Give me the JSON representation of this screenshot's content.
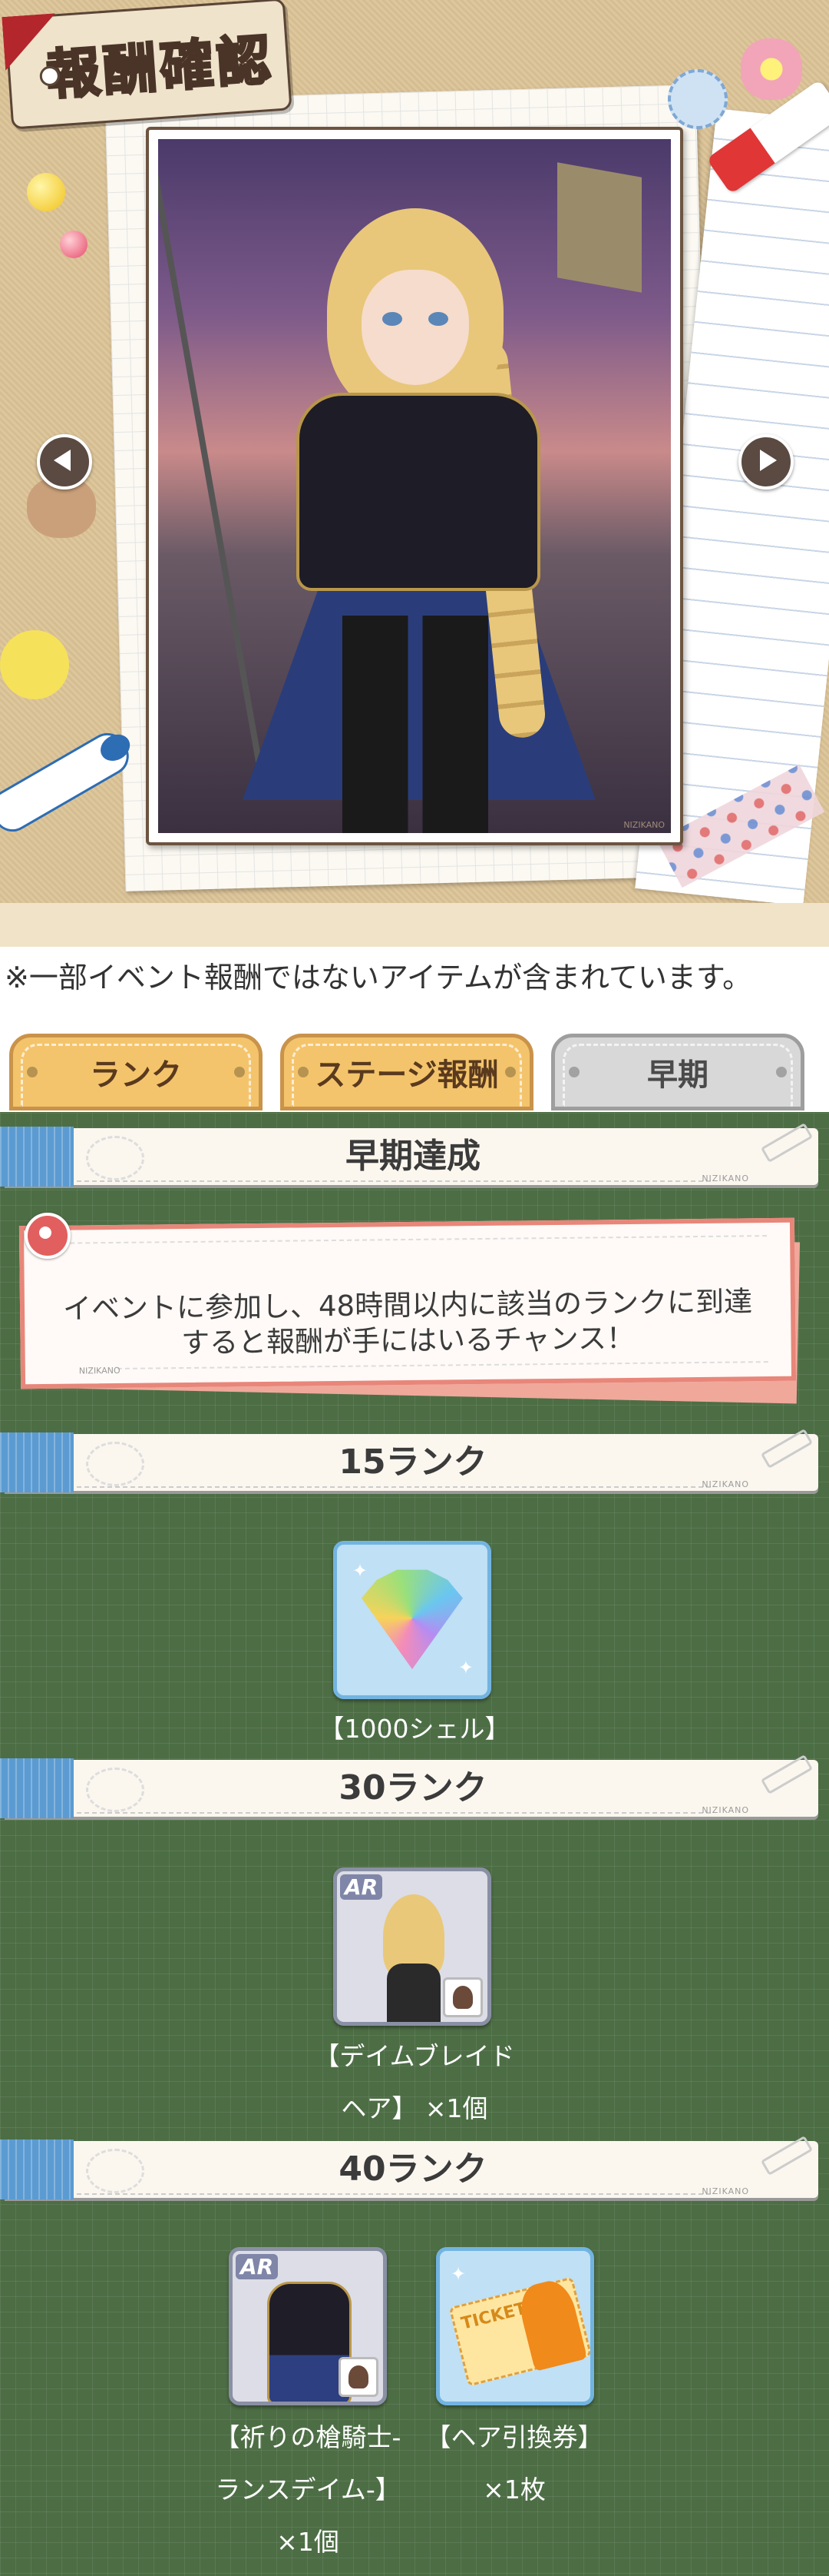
{
  "title": "報酬確認",
  "banner": {
    "signature": "NIZIKANO"
  },
  "notice": "※一部イベント報酬ではないアイテムが含まれています。",
  "tabs": [
    {
      "label": "ランク",
      "active": false
    },
    {
      "label": "ステージ報酬",
      "active": false
    },
    {
      "label": "早期",
      "active": true
    }
  ],
  "section_header": {
    "title": "早期達成",
    "stamp": "NIZIKANO"
  },
  "info": {
    "message": "イベントに参加し、48時間以内に該当のランクに到達すると報酬が手にはいるチャンス！",
    "stamp": "NIZIKANO"
  },
  "ranks": [
    {
      "title": "15ランク",
      "items": [
        {
          "icon": "rainbow-shell-icon",
          "caption_lines": [
            "【1000シェル】"
          ]
        }
      ]
    },
    {
      "title": "30ランク",
      "items": [
        {
          "icon": "hair-item-icon",
          "rarity": "AR",
          "caption_lines": [
            "【デイムブレイド",
            "ヘア】 ×1個"
          ]
        }
      ]
    },
    {
      "title": "40ランク",
      "items": [
        {
          "icon": "outfit-item-icon",
          "rarity": "AR",
          "caption_lines": [
            "【祈りの槍騎士-",
            "ランスデイム-】",
            "×1個"
          ]
        },
        {
          "icon": "ticket-icon",
          "caption_lines": [
            "【ヘア引換券】",
            "×1枚"
          ]
        }
      ]
    }
  ],
  "colors": {
    "background_green": "#4d6e45",
    "tab_active": "#d8d8d8",
    "tab_inactive": "#f4c46c",
    "header_accent": "#5b9bd2",
    "info_border": "#e8867a"
  }
}
